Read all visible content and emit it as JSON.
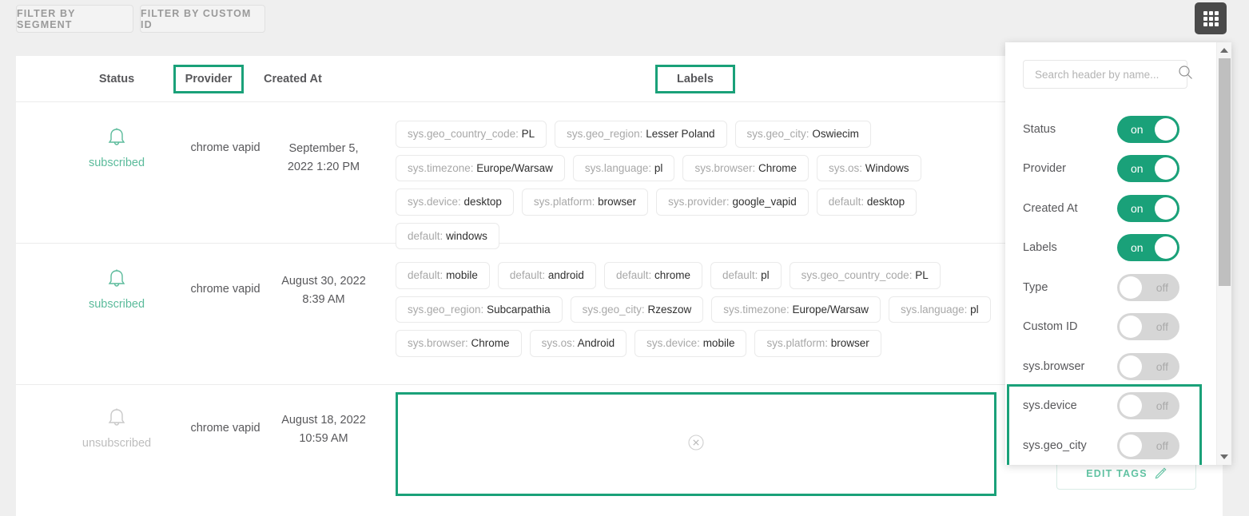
{
  "toolbar": {
    "filter_segment": "FILTER BY SEGMENT",
    "filter_custom_id": "FILTER BY CUSTOM ID",
    "grid_button_icon": "grid-icon"
  },
  "table": {
    "headers": {
      "status": "Status",
      "provider": "Provider",
      "created_at": "Created At",
      "labels": "Labels"
    },
    "rows": [
      {
        "status": "subscribed",
        "status_icon": "bell-icon",
        "provider": "chrome vapid",
        "created_at": "September 5, 2022 1:20 PM",
        "labels": [
          {
            "key": "sys.geo_country_code:",
            "value": "PL"
          },
          {
            "key": "sys.geo_region:",
            "value": "Lesser Poland"
          },
          {
            "key": "sys.geo_city:",
            "value": "Oswiecim"
          },
          {
            "key": "sys.timezone:",
            "value": "Europe/Warsaw"
          },
          {
            "key": "sys.language:",
            "value": "pl"
          },
          {
            "key": "sys.browser:",
            "value": "Chrome"
          },
          {
            "key": "sys.os:",
            "value": "Windows"
          },
          {
            "key": "sys.device:",
            "value": "desktop"
          },
          {
            "key": "sys.platform:",
            "value": "browser"
          },
          {
            "key": "sys.provider:",
            "value": "google_vapid"
          },
          {
            "key": "default:",
            "value": "desktop"
          },
          {
            "key": "default:",
            "value": "windows"
          }
        ]
      },
      {
        "status": "subscribed",
        "status_icon": "bell-icon",
        "provider": "chrome vapid",
        "created_at": "August 30, 2022 8:39 AM",
        "labels": [
          {
            "key": "default:",
            "value": "mobile"
          },
          {
            "key": "default:",
            "value": "android"
          },
          {
            "key": "default:",
            "value": "chrome"
          },
          {
            "key": "default:",
            "value": "pl"
          },
          {
            "key": "sys.geo_country_code:",
            "value": "PL"
          },
          {
            "key": "sys.geo_region:",
            "value": "Subcarpathia"
          },
          {
            "key": "sys.geo_city:",
            "value": "Rzeszow"
          },
          {
            "key": "sys.timezone:",
            "value": "Europe/Warsaw"
          },
          {
            "key": "sys.language:",
            "value": "pl"
          },
          {
            "key": "sys.browser:",
            "value": "Chrome"
          },
          {
            "key": "sys.os:",
            "value": "Android"
          },
          {
            "key": "sys.device:",
            "value": "mobile"
          },
          {
            "key": "sys.platform:",
            "value": "browser"
          }
        ]
      },
      {
        "status": "unsubscribed",
        "status_icon": "bell-icon",
        "provider": "chrome vapid",
        "created_at": "August 18, 2022 10:59 AM",
        "labels": [],
        "empty_icon": "circle-x-icon"
      }
    ]
  },
  "edit_tags": {
    "label": "EDIT TAGS",
    "icon": "pencil-icon"
  },
  "header_panel": {
    "search": {
      "placeholder": "Search header by name...",
      "value": "",
      "icon": "search-icon"
    },
    "toggles": [
      {
        "label": "Status",
        "state": "on"
      },
      {
        "label": "Provider",
        "state": "on"
      },
      {
        "label": "Created At",
        "state": "on"
      },
      {
        "label": "Labels",
        "state": "on"
      },
      {
        "label": "Type",
        "state": "off"
      },
      {
        "label": "Custom ID",
        "state": "off"
      },
      {
        "label": "sys.browser",
        "state": "off"
      },
      {
        "label": "sys.device",
        "state": "off"
      },
      {
        "label": "sys.geo_city",
        "state": "off"
      }
    ],
    "scrollbar": {
      "up_icon": "caret-up-icon",
      "down_icon": "caret-down-icon"
    }
  },
  "colors": {
    "accent": "#1aa179",
    "toggle_on": "#1aa179",
    "toggle_off": "#d6d6d6",
    "status_subscribed": "#5bbb9b",
    "status_unsubscribed": "#bdbdbd",
    "page_background": "#efefef",
    "grid_button": "#4a4a4a"
  }
}
